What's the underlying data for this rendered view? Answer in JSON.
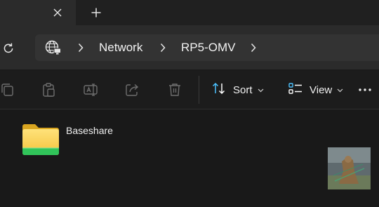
{
  "breadcrumb": {
    "items": [
      "Network",
      "RP5-OMV"
    ]
  },
  "toolbar": {
    "sort_label": "Sort",
    "view_label": "View"
  },
  "content": {
    "folders": [
      {
        "name": "Baseshare"
      }
    ]
  },
  "colors": {
    "accent": "#4cc2ff",
    "folder_yellow": "#f6c94b",
    "folder_green": "#31c45a"
  },
  "icons": {
    "tab_close": "close-icon",
    "new_tab": "plus-icon",
    "refresh": "refresh-icon",
    "location": "globe-icon",
    "sort": "sort-arrows-icon",
    "view": "view-list-icon",
    "more": "more-icon"
  }
}
